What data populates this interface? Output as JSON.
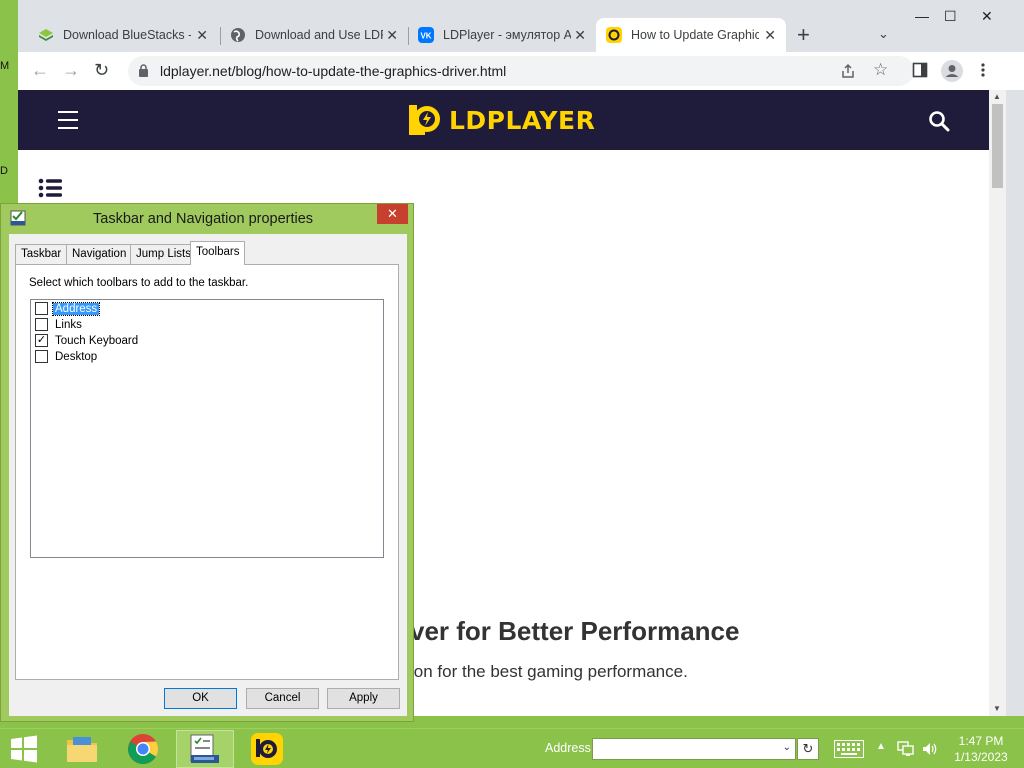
{
  "desktop": {
    "edge_labels": [
      "M",
      "D"
    ]
  },
  "browser": {
    "tabs": [
      {
        "title": "Download BlueStacks -",
        "icon": "bluestacks-icon"
      },
      {
        "title": "Download and Use LDP",
        "icon": "globe-icon"
      },
      {
        "title": "LDPlayer - эмулятор Ar",
        "icon": "vk-icon"
      },
      {
        "title": "How to Update Graphic",
        "icon": "ldplayer-icon",
        "active": true
      }
    ],
    "vk_glyph": "VK",
    "url": "ldplayer.net/blog/how-to-update-the-graphics-driver.html",
    "window_controls": {
      "minimize": "—",
      "maximize": "☐",
      "close": "✕"
    }
  },
  "page": {
    "logo_text": "LDPLAYER",
    "article_title": "ver for Better Performance",
    "article_subtitle": "ion for the best gaming performance."
  },
  "dialog": {
    "title": "Taskbar and Navigation properties",
    "tabs": [
      "Taskbar",
      "Navigation",
      "Jump Lists",
      "Toolbars"
    ],
    "active_tab": "Toolbars",
    "instruction": "Select which toolbars to add to the taskbar.",
    "toolbars": [
      {
        "label": "Address",
        "checked": false,
        "selected": true
      },
      {
        "label": "Links",
        "checked": false
      },
      {
        "label": "Touch Keyboard",
        "checked": true
      },
      {
        "label": "Desktop",
        "checked": false
      }
    ],
    "check_mark": "✓",
    "buttons": {
      "ok": "OK",
      "cancel": "Cancel",
      "apply": "Apply"
    }
  },
  "taskbar": {
    "address_label": "Address",
    "address_value": "",
    "refresh_glyph": "↻",
    "time": "1:47 PM",
    "date": "1/13/2023"
  },
  "colors": {
    "desktop": "#8bc24a",
    "site_header": "#1e1c3a",
    "logo": "#ffd400",
    "close_button": "#c7402d"
  }
}
